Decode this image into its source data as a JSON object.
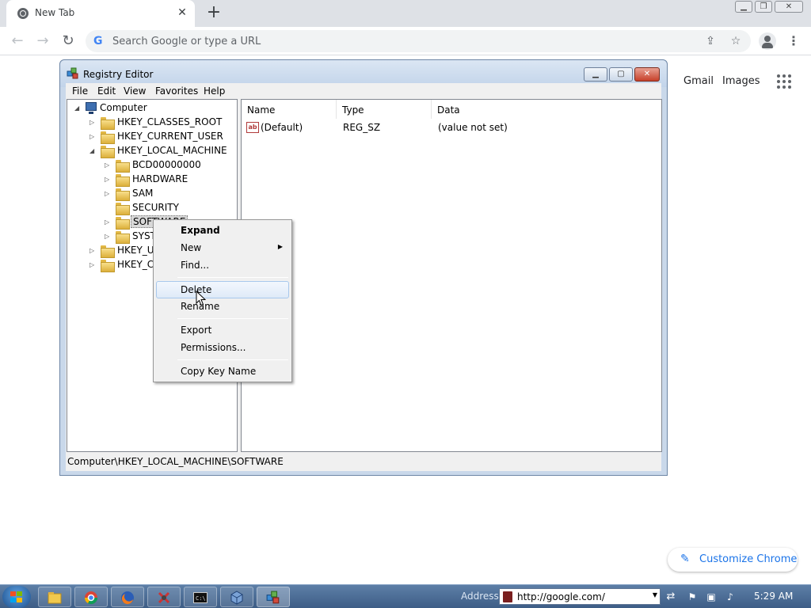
{
  "browser": {
    "tab_title": "New Tab",
    "tab_close": "✕",
    "new_tab": "+",
    "omnibox_placeholder": "Search Google or type a URL",
    "ntp_links": {
      "gmail": "Gmail",
      "images": "Images"
    },
    "customize_label": "Customize Chrome",
    "icons": [
      "chrome-favicon-icon",
      "close-icon",
      "plus-icon",
      "back-icon",
      "forward-icon",
      "reload-icon",
      "google-g-icon",
      "share-icon",
      "star-icon",
      "profile-icon",
      "kebab-menu-icon",
      "apps-grid-icon",
      "pencil-icon"
    ]
  },
  "regedit": {
    "title": "Registry Editor",
    "menu": [
      "File",
      "Edit",
      "View",
      "Favorites",
      "Help"
    ],
    "tree": {
      "root": "Computer",
      "hives": [
        {
          "label": "HKEY_CLASSES_ROOT"
        },
        {
          "label": "HKEY_CURRENT_USER"
        },
        {
          "label": "HKEY_LOCAL_MACHINE"
        },
        {
          "label": "HKEY_US"
        },
        {
          "label": "HKEY_CU"
        }
      ],
      "hklm_children": [
        {
          "label": "BCD00000000"
        },
        {
          "label": "HARDWARE"
        },
        {
          "label": "SAM"
        },
        {
          "label": "SECURITY"
        },
        {
          "label": "SOFTWARE"
        },
        {
          "label": "SYST"
        }
      ],
      "selected": "SOFTWARE"
    },
    "columns": [
      "Name",
      "Type",
      "Data"
    ],
    "rows": [
      {
        "icon": "ab",
        "name": "(Default)",
        "type": "REG_SZ",
        "data": "(value not set)"
      }
    ],
    "status": "Computer\\HKEY_LOCAL_MACHINE\\SOFTWARE"
  },
  "context_menu": {
    "items": [
      "Expand",
      "New",
      "Find...",
      "Delete",
      "Rename",
      "Export",
      "Permissions...",
      "Copy Key Name"
    ],
    "default_item": "Expand",
    "hovered_item": "Delete"
  },
  "taskbar": {
    "address_label": "Address",
    "address_value": "http://google.com/",
    "clock": "5:29 AM",
    "colors": {
      "start_flag": [
        "#f25022",
        "#7fba00",
        "#00a4ef",
        "#ffb900"
      ]
    }
  }
}
